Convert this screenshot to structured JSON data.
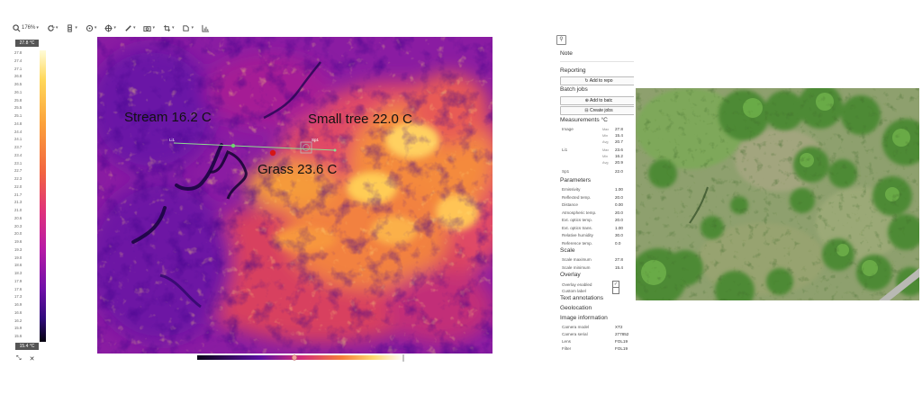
{
  "toolbar": {
    "zoom": "176%",
    "icons": [
      "zoom-icon",
      "rotate-icon",
      "palette-icon",
      "measure-icon",
      "target-icon",
      "brush-icon",
      "camera-icon",
      "crop-icon",
      "transform-icon",
      "histogram-icon"
    ]
  },
  "scale": {
    "max_label": "27.8 °C",
    "min_label": "15.4 °C",
    "ticks": [
      "27.8",
      "27.4",
      "27.1",
      "26.8",
      "26.5",
      "26.1",
      "25.8",
      "25.5",
      "25.1",
      "24.8",
      "24.4",
      "24.1",
      "23.7",
      "23.4",
      "23.1",
      "22.7",
      "22.3",
      "22.0",
      "21.7",
      "21.3",
      "21.0",
      "20.6",
      "20.3",
      "20.0",
      "19.6",
      "19.3",
      "19.0",
      "18.6",
      "18.3",
      "17.9",
      "17.6",
      "17.3",
      "16.9",
      "16.6",
      "16.2",
      "15.9",
      "15.6"
    ]
  },
  "annotations": {
    "stream": "Stream 16.2 C",
    "small_tree": "Small tree 22.0 C",
    "grass": "Grass 23.6 C"
  },
  "markers": {
    "line_label": "Li1",
    "spot_label": "Sp1"
  },
  "panel": {
    "note": "Note",
    "reporting": "Reporting",
    "add_to_report": "Add to repo",
    "batch_jobs": "Batch jobs",
    "add_to_batch": "Add to batc",
    "create_jobs": "Create jobs",
    "measurements_title": "Measurements °C",
    "image_label": "Image",
    "image_max_label": "Max",
    "image_max": "27.8",
    "image_min_label": "Min",
    "image_min": "15.4",
    "image_avg_label": "Avg",
    "image_avg": "20.7",
    "li1_label": "Li1",
    "li1_max_label": "Max",
    "li1_max": "23.6",
    "li1_min_label": "Min",
    "li1_min": "16.2",
    "li1_avg_label": "Avg",
    "li1_avg": "20.9",
    "sp1_label": "Sp1",
    "sp1_value": "22.0",
    "parameters": "Parameters",
    "params": [
      {
        "label": "Emissivity",
        "value": "1.00"
      },
      {
        "label": "Reflected temp.",
        "value": "20.0"
      },
      {
        "label": "Distance",
        "value": "0.00"
      },
      {
        "label": "Atmospheric temp.",
        "value": "20.0"
      },
      {
        "label": "Ext. optics temp.",
        "value": "20.0"
      },
      {
        "label": "Ext. optics trans.",
        "value": "1.00"
      },
      {
        "label": "Relative humidity",
        "value": "30.0"
      },
      {
        "label": "Reference temp.",
        "value": "0.0"
      }
    ],
    "scale_title": "Scale",
    "scale_max_label": "Scale maximum",
    "scale_max": "27.8",
    "scale_min_label": "Scale minimum",
    "scale_min": "15.4",
    "overlay_title": "Overlay",
    "overlay_enabled": "Overlay enabled",
    "custom_label": "Custom label",
    "text_annotations": "Text annotations",
    "geolocation": "Geolocation",
    "image_info": "Image information",
    "camera_model_label": "Camera model",
    "camera_model": "XT2",
    "camera_serial_label": "Camera serial",
    "camera_serial": "277852",
    "lens_label": "Lens",
    "lens": "FOL19",
    "filter_label": "Filter",
    "filter": "FOL19"
  },
  "bottom": {
    "icon_a": "⤡",
    "icon_b": "✕"
  }
}
